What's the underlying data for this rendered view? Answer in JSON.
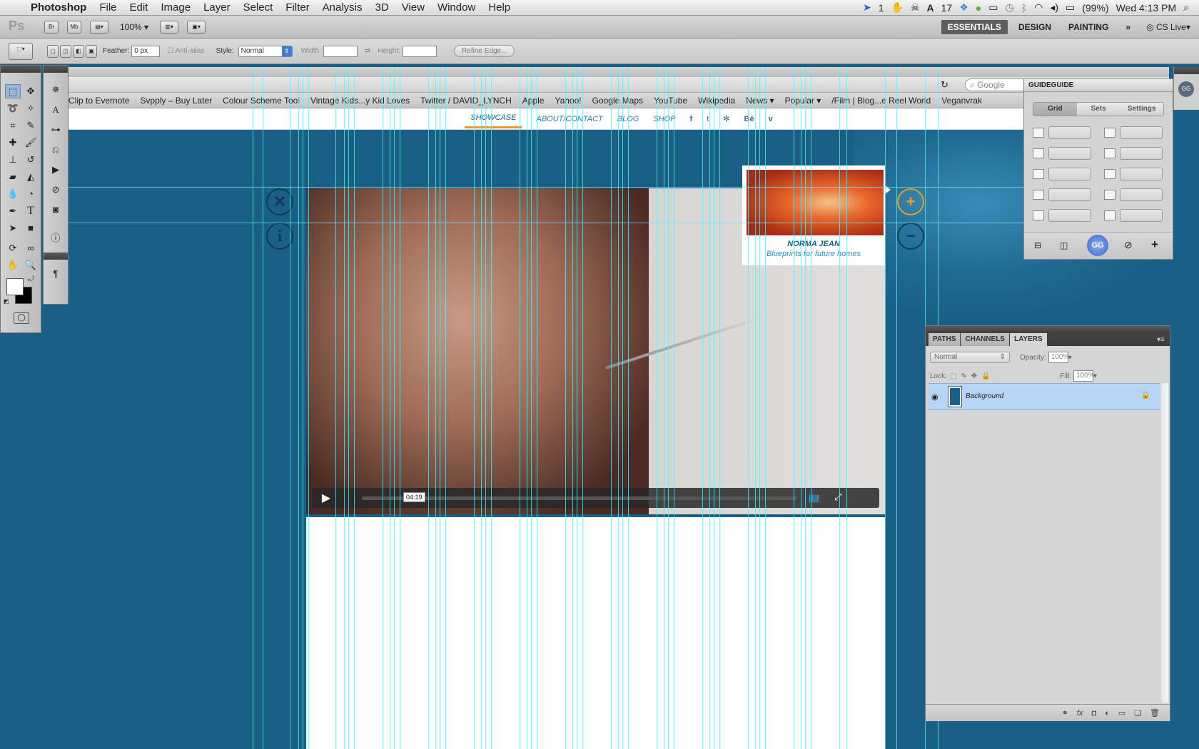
{
  "menubar": {
    "app_name": "Photoshop",
    "items": [
      "File",
      "Edit",
      "Image",
      "Layer",
      "Select",
      "Filter",
      "Analysis",
      "3D",
      "View",
      "Window",
      "Help"
    ],
    "status": {
      "notif1": "1",
      "notif2": "17",
      "battery": "(99%)",
      "clock": "Wed 4:13 PM"
    }
  },
  "appbar": {
    "logo": "Ps",
    "br": "Br",
    "mb": "Mb",
    "zoom": "100%",
    "workspaces": [
      "ESSENTIALS",
      "DESIGN",
      "PAINTING"
    ],
    "more": "»",
    "cslive": "CS Live"
  },
  "options": {
    "feather_label": "Feather:",
    "feather_value": "0 px",
    "antialias_label": "Anti-alias",
    "style_label": "Style:",
    "style_value": "Normal",
    "width_label": "Width:",
    "height_label": "Height:",
    "refine_label": "Refine Edge..."
  },
  "browser": {
    "search_placeholder": "Google",
    "bookmarks": [
      "Clip to Evernote",
      "Svpply – Buy Later",
      "Colour Scheme Tool",
      "Vintage Kids...y Kid Loves",
      "Twitter / DAVID_LYNCH",
      "Apple",
      "Yahoo!",
      "Google Maps",
      "YouTube",
      "Wikipedia",
      "News ▾",
      "Popular ▾",
      "/Film | Blog...e Reel World",
      "Veganvrak"
    ]
  },
  "site": {
    "nav": [
      "SHOWCASE",
      "ABOUT/CONTACT",
      "BLOG",
      "SHOP"
    ],
    "social": [
      "f",
      "t",
      "✻",
      "Bē",
      "v"
    ],
    "card_title": "NORMA JEAN",
    "card_subtitle": "Blueprints for future homes",
    "video_time": "04:19"
  },
  "guideguide": {
    "title": "GUIDEGUIDE",
    "tabs": [
      "Grid",
      "Sets",
      "Settings"
    ],
    "badge": "GG"
  },
  "layers": {
    "tabs": [
      "PATHS",
      "CHANNELS",
      "LAYERS"
    ],
    "blend_mode": "Normal",
    "opacity_label": "Opacity:",
    "opacity_value": "100%",
    "lock_label": "Lock:",
    "fill_label": "Fill:",
    "fill_value": "100%",
    "layer_name": "Background",
    "bottom_icons": [
      "⚭",
      "fx",
      "◘",
      "◐",
      "▭",
      "❏",
      "🗑"
    ]
  },
  "colors": {
    "accent": "#1a5f85",
    "guide": "#6fe6ef",
    "orange": "#e5a020"
  }
}
